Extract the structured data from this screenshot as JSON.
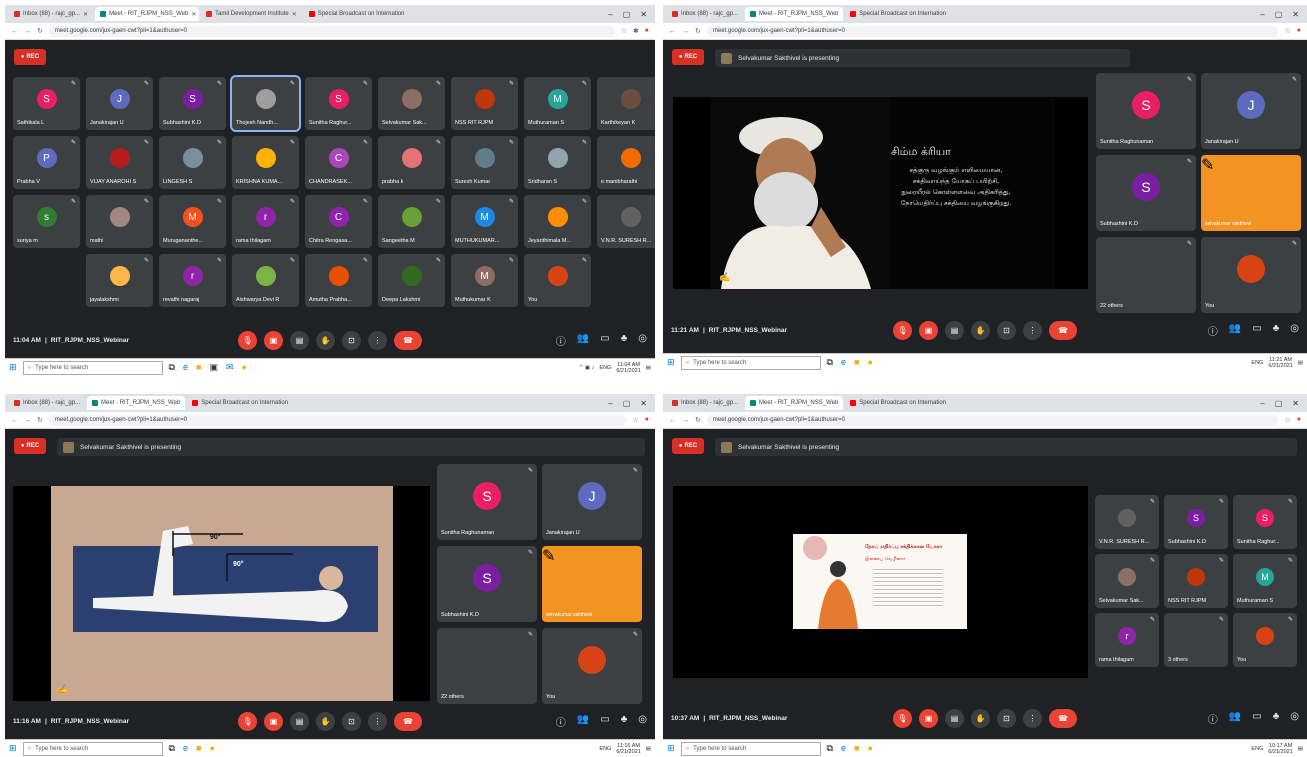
{
  "colors": {
    "meet_bg": "#202124",
    "tile": "#3c4043",
    "rec": "#d93025",
    "end_call": "#ea4335",
    "orange_tile": "#f29322"
  },
  "panels": [
    {
      "tabs": [
        "Inbox (88) - rajc_gp...",
        "Meet - RIT_RJPM_NSS_Web",
        "Tamil Development Institute",
        "Special Broadcast on Internation"
      ],
      "url": "meet.google.com/jux-gaen-cwt?pli=1&authuser=0",
      "rec": "REC",
      "time": "11:04 AM",
      "meeting": "RIT_RJPM_NSS_Webinar",
      "clock_time": "11:04 AM",
      "clock_date": "6/21/2021",
      "lang": "ENG",
      "search_placeholder": "Type here to search",
      "participants": [
        {
          "name": "Sathikala L",
          "initial": "S",
          "color": "#e91e63"
        },
        {
          "name": "Janakirajan U",
          "initial": "J",
          "color": "#5c6bc0"
        },
        {
          "name": "Subhashini K.D",
          "initial": "S",
          "color": "#7b1fa2"
        },
        {
          "name": "Thojesh Nandh...",
          "initial": "",
          "color": "#9e9e9e"
        },
        {
          "name": "Sunitha Raghur...",
          "initial": "S",
          "color": "#e91e63"
        },
        {
          "name": "Selvakumar Sak...",
          "initial": "",
          "color": "#8d6e63"
        },
        {
          "name": "NSS RIT RJPM",
          "initial": "",
          "color": "#bf360c"
        },
        {
          "name": "Muthuraman S",
          "initial": "M",
          "color": "#26a69a"
        },
        {
          "name": "Karthikeyan K",
          "initial": "",
          "color": "#6d4c41"
        },
        {
          "name": "Prabha V",
          "initial": "P",
          "color": "#5c6bc0"
        },
        {
          "name": "VIJAY ANAROHI S",
          "initial": "",
          "color": "#b71c1c"
        },
        {
          "name": "LINGESH S",
          "initial": "",
          "color": "#78909c"
        },
        {
          "name": "KRISHNA KUMA...",
          "initial": "",
          "color": "#ffb300"
        },
        {
          "name": "CHANDRASEK...",
          "initial": "C",
          "color": "#ab47bc"
        },
        {
          "name": "prabha k",
          "initial": "",
          "color": "#e57373"
        },
        {
          "name": "Suresh Kumar",
          "initial": "",
          "color": "#607d8b"
        },
        {
          "name": "Sridharan S",
          "initial": "",
          "color": "#90a4ae"
        },
        {
          "name": "e.manibharathi",
          "initial": "",
          "color": "#ef6c00"
        },
        {
          "name": "suriya m",
          "initial": "s",
          "color": "#2e7d32"
        },
        {
          "name": "mathi",
          "initial": "",
          "color": "#a1887f"
        },
        {
          "name": "Murugananthe...",
          "initial": "M",
          "color": "#f4511e"
        },
        {
          "name": "rama thilagam",
          "initial": "r",
          "color": "#8e24aa"
        },
        {
          "name": "Chitra Rengasa...",
          "initial": "C",
          "color": "#8e24aa"
        },
        {
          "name": "Sangeetha M",
          "initial": "",
          "color": "#689f38"
        },
        {
          "name": "MUTHUKUMAR...",
          "initial": "M",
          "color": "#1e88e5"
        },
        {
          "name": "Jeyanthimala M...",
          "initial": "",
          "color": "#ff8f00"
        },
        {
          "name": "V.N.R. SURESH R...",
          "initial": "",
          "color": "#616161"
        },
        {
          "name": "jayalakshmi",
          "initial": "",
          "color": "#ffb74d"
        },
        {
          "name": "revathi nagaraj",
          "initial": "r",
          "color": "#8e24aa"
        },
        {
          "name": "Aishwarya Devi R",
          "initial": "",
          "color": "#7cb342"
        },
        {
          "name": "Amutha Prabha...",
          "initial": "",
          "color": "#e65100"
        },
        {
          "name": "Deepa Lakshmi",
          "initial": "",
          "color": "#33691e"
        },
        {
          "name": "Muthukumar K",
          "initial": "M",
          "color": "#8d6e63"
        },
        {
          "name": "You",
          "initial": "",
          "color": "#d84315"
        }
      ]
    },
    {
      "present_text": "Selvakumar Sakthivel is presenting",
      "time": "11:21 AM",
      "meeting": "RIT_RJPM_NSS_Webinar",
      "clock_time": "11:21 AM",
      "clock_date": "6/21/2021",
      "slide_title": "சிம்ம க்ரியா",
      "slide_lines": [
        "சத்குரு வழங்கும் எளிமையான,",
        "சக்திவாய்ந்த யோகப் பயிற்சி,",
        "நுரையீரல் கொள்ளளவை அதிகரித்து,",
        "நோயெதிர்ப்பு சக்தியை வழங்குகிறது."
      ],
      "side": [
        {
          "name": "Sunitha Raghunaman",
          "initial": "S",
          "color": "#e91e63"
        },
        {
          "name": "Janakirajan U",
          "initial": "J",
          "color": "#5c6bc0"
        },
        {
          "name": "Subhashini K.D",
          "initial": "S",
          "color": "#7b1fa2"
        },
        {
          "name": "selvakumar sakthivel",
          "initial": "",
          "color": "#f29322"
        },
        {
          "name": "22 others",
          "initial": "",
          "color": "#3c4043"
        },
        {
          "name": "You",
          "initial": "",
          "color": "#d84315"
        }
      ]
    },
    {
      "present_text": "Selvakumar Sakthivel is presenting",
      "time": "11:16 AM",
      "meeting": "RIT_RJPM_NSS_Webinar",
      "clock_time": "11:16 AM",
      "clock_date": "6/21/2021",
      "angle_a": "90°",
      "angle_b": "90°",
      "side": [
        {
          "name": "Sunitha Raghunaman",
          "initial": "S",
          "color": "#e91e63"
        },
        {
          "name": "Janakirajan U",
          "initial": "J",
          "color": "#5c6bc0"
        },
        {
          "name": "Subhashini K.D",
          "initial": "S",
          "color": "#7b1fa2"
        },
        {
          "name": "selvakumar sakthivel",
          "initial": "",
          "color": "#f29322"
        },
        {
          "name": "22 others",
          "initial": "",
          "color": "#3c4043"
        },
        {
          "name": "You",
          "initial": "",
          "color": "#d84315"
        }
      ]
    },
    {
      "present_text": "Selvakumar Sakthivel is presenting",
      "time": "10:37 AM",
      "meeting": "RIT_RJPM_NSS_Webinar",
      "clock_time": "10:17 AM",
      "clock_date": "6/21/2021",
      "poster_title": "நோய் எதிர்ப்பு சக்திக்கான யோகா",
      "poster_sub": "இணைய வெபினார்",
      "side": [
        {
          "name": "V.N.R. SURESH R...",
          "initial": "",
          "color": "#616161"
        },
        {
          "name": "Subhashini K.D",
          "initial": "S",
          "color": "#7b1fa2"
        },
        {
          "name": "Sunitha Raghur...",
          "initial": "S",
          "color": "#e91e63"
        },
        {
          "name": "Selvakumar Sak...",
          "initial": "",
          "color": "#8d6e63"
        },
        {
          "name": "NSS RIT RJPM",
          "initial": "",
          "color": "#bf360c"
        },
        {
          "name": "Muthuraman S",
          "initial": "M",
          "color": "#26a69a"
        },
        {
          "name": "rama thilagam",
          "initial": "r",
          "color": "#8e24aa"
        },
        {
          "name": "3 others",
          "initial": "",
          "color": "#3c4043"
        },
        {
          "name": "You",
          "initial": "",
          "color": "#d84315"
        }
      ]
    }
  ]
}
